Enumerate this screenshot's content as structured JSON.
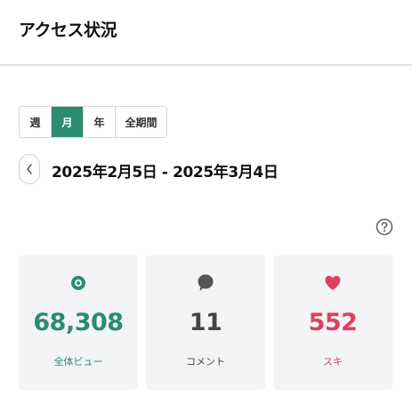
{
  "header": {
    "title": "アクセス状況"
  },
  "period_tabs": [
    {
      "label": "週",
      "active": false
    },
    {
      "label": "月",
      "active": true
    },
    {
      "label": "年",
      "active": false
    },
    {
      "label": "全期間",
      "active": false
    }
  ],
  "date_range": {
    "text": "2025年2月5日 - 2025年3月4日"
  },
  "help": {
    "icon": "question-circle-icon"
  },
  "stats": {
    "views": {
      "value": "68,308",
      "label": "全体ビュー",
      "icon": "eye-icon",
      "color": "#2b8c72"
    },
    "comments": {
      "value": "11",
      "label": "コメント",
      "icon": "speech-bubble-icon",
      "color": "#444444"
    },
    "likes": {
      "value": "552",
      "label": "スキ",
      "icon": "heart-icon",
      "color": "#e03e60"
    }
  },
  "colors": {
    "accent": "#2b8c72",
    "card_bg": "#f2f4f5"
  }
}
